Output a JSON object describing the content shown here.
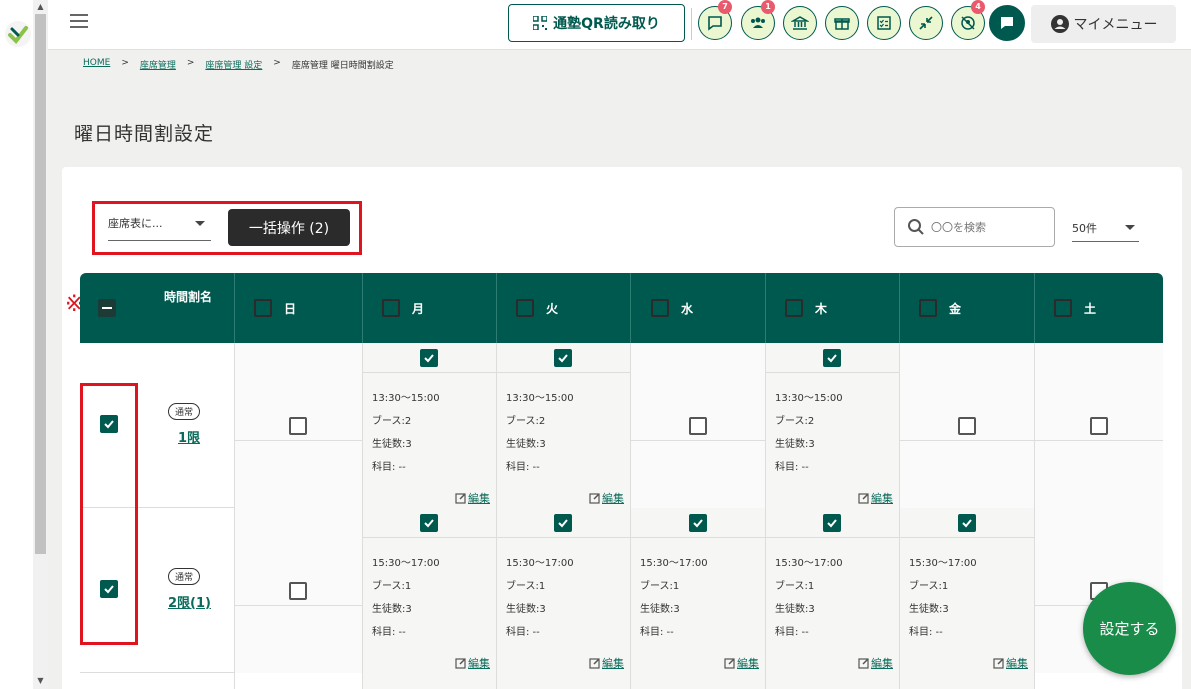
{
  "topbar": {
    "qr_label": "通塾QR読み取り",
    "icons": [
      {
        "name": "message-icon",
        "badge": "7"
      },
      {
        "name": "people-icon",
        "badge": "1"
      },
      {
        "name": "bank-icon",
        "badge": ""
      },
      {
        "name": "gift-icon",
        "badge": ""
      },
      {
        "name": "checklist-icon",
        "badge": ""
      },
      {
        "name": "compress-icon",
        "badge": ""
      },
      {
        "name": "location-off-icon",
        "badge": "4"
      },
      {
        "name": "chat-icon",
        "badge": ""
      }
    ],
    "my_menu_label": "マイメニュー"
  },
  "breadcrumb": [
    "HOME",
    "座席管理",
    "座席管理 設定",
    "座席管理 曜日時間割設定"
  ],
  "page_title": "曜日時間割設定",
  "toolbar": {
    "select_value": "座席表に...",
    "bulk_label": "一括操作 (2)",
    "search_placeholder": "〇〇を検索",
    "perpage_value": "50件"
  },
  "table": {
    "period_header": "時間割名",
    "kome": "※",
    "days": [
      "日",
      "月",
      "火",
      "水",
      "木",
      "金",
      "土"
    ],
    "edit_label": "編集",
    "rows": [
      {
        "badge": "通常",
        "name": "1限",
        "cells": [
          null,
          {
            "time": "13:30〜15:00",
            "booth": "ブース:2",
            "students": "生徒数:3",
            "subject": "科目: --"
          },
          {
            "time": "13:30〜15:00",
            "booth": "ブース:2",
            "students": "生徒数:3",
            "subject": "科目: --"
          },
          null,
          {
            "time": "13:30〜15:00",
            "booth": "ブース:2",
            "students": "生徒数:3",
            "subject": "科目: --"
          },
          null,
          null
        ]
      },
      {
        "badge": "通常",
        "name": "2限(1)",
        "cells": [
          null,
          {
            "time": "15:30〜17:00",
            "booth": "ブース:1",
            "students": "生徒数:3",
            "subject": "科目: --"
          },
          {
            "time": "15:30〜17:00",
            "booth": "ブース:1",
            "students": "生徒数:3",
            "subject": "科目: --"
          },
          {
            "time": "15:30〜17:00",
            "booth": "ブース:1",
            "students": "生徒数:3",
            "subject": "科目: --"
          },
          {
            "time": "15:30〜17:00",
            "booth": "ブース:1",
            "students": "生徒数:3",
            "subject": "科目: --"
          },
          {
            "time": "15:30〜17:00",
            "booth": "ブース:1",
            "students": "生徒数:3",
            "subject": "科目: --"
          },
          null
        ]
      }
    ]
  },
  "fab_label": "設定する",
  "colors": {
    "primary": "#00594f",
    "accent_red": "#e0141e",
    "fab": "#1a8c4a"
  }
}
